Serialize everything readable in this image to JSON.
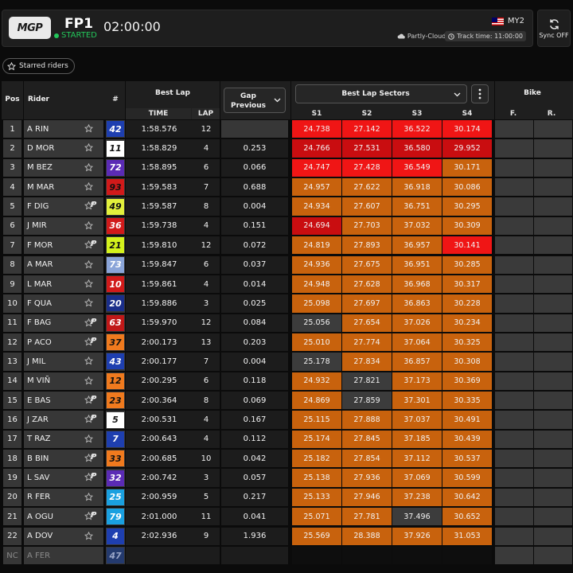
{
  "header": {
    "logo_text": "MGP",
    "session": "FP1",
    "status": "STARTED",
    "clock": "02:00:00",
    "circuit": "MY2",
    "weather": "Partly-Cloudy",
    "track_time": "Track time: 11:00:00",
    "sync_label": "Sync OFF"
  },
  "starred_label": "Starred riders",
  "columns": {
    "pos": "Pos",
    "rider": "Rider",
    "num": "#",
    "best_lap": "Best Lap",
    "time": "TIME",
    "lap": "LAP",
    "gap": "Gap Previous",
    "sectors": "Best Lap Sectors",
    "s1": "S1",
    "s2": "S2",
    "s3": "S3",
    "s4": "S4",
    "bike": "Bike",
    "f": "F.",
    "r": "R."
  },
  "colors": {
    "purple": "#f01515",
    "red_dark": "#c90d10",
    "orange": "#c8620d",
    "grey": "#3c3c3c",
    "green": "#23c65a"
  },
  "rows": [
    {
      "pos": "1",
      "rider": "A RIN",
      "p": false,
      "num": "42",
      "num_bg": "#1e3fb0",
      "num_fg": "#ffffff",
      "time": "1:58.576",
      "lap": "12",
      "gap": "",
      "s": [
        "24.738",
        "27.142",
        "36.522",
        "30.174"
      ],
      "sc": [
        "#f01515",
        "#f01515",
        "#f01515",
        "#f01515"
      ]
    },
    {
      "pos": "2",
      "rider": "D MOR",
      "p": false,
      "num": "11",
      "num_bg": "#ffffff",
      "num_fg": "#111111",
      "time": "1:58.829",
      "lap": "4",
      "gap": "0.253",
      "s": [
        "24.766",
        "27.531",
        "36.580",
        "29.952"
      ],
      "sc": [
        "#c90d10",
        "#c90d10",
        "#c90d10",
        "#c90d10"
      ]
    },
    {
      "pos": "3",
      "rider": "M BEZ",
      "p": false,
      "num": "72",
      "num_bg": "#5b2bb5",
      "num_fg": "#ffffff",
      "time": "1:58.895",
      "lap": "6",
      "gap": "0.066",
      "s": [
        "24.747",
        "27.428",
        "36.549",
        "30.171"
      ],
      "sc": [
        "#f01515",
        "#f01515",
        "#f01515",
        "#c8620d"
      ]
    },
    {
      "pos": "4",
      "rider": "M MAR",
      "p": false,
      "num": "93",
      "num_bg": "#d11a1a",
      "num_fg": "#111111",
      "time": "1:59.583",
      "lap": "7",
      "gap": "0.688",
      "s": [
        "24.957",
        "27.622",
        "36.918",
        "30.086"
      ],
      "sc": [
        "#c8620d",
        "#c8620d",
        "#c8620d",
        "#c8620d"
      ]
    },
    {
      "pos": "5",
      "rider": "F DIG",
      "p": true,
      "num": "49",
      "num_bg": "#e2f03c",
      "num_fg": "#111111",
      "time": "1:59.587",
      "lap": "8",
      "gap": "0.004",
      "s": [
        "24.934",
        "27.607",
        "36.751",
        "30.295"
      ],
      "sc": [
        "#c8620d",
        "#c8620d",
        "#c8620d",
        "#c8620d"
      ]
    },
    {
      "pos": "6",
      "rider": "J MIR",
      "p": false,
      "num": "36",
      "num_bg": "#d11a1a",
      "num_fg": "#ffffff",
      "time": "1:59.738",
      "lap": "4",
      "gap": "0.151",
      "s": [
        "24.694",
        "27.703",
        "37.032",
        "30.309"
      ],
      "sc": [
        "#c90d10",
        "#c8620d",
        "#c8620d",
        "#c8620d"
      ]
    },
    {
      "pos": "7",
      "rider": "F MOR",
      "p": true,
      "num": "21",
      "num_bg": "#d4f21c",
      "num_fg": "#111111",
      "time": "1:59.810",
      "lap": "12",
      "gap": "0.072",
      "s": [
        "24.819",
        "27.893",
        "36.957",
        "30.141"
      ],
      "sc": [
        "#c8620d",
        "#c8620d",
        "#c8620d",
        "#f01515"
      ]
    },
    {
      "pos": "8",
      "rider": "A MAR",
      "p": false,
      "num": "73",
      "num_bg": "#8aa4d8",
      "num_fg": "#ffffff",
      "time": "1:59.847",
      "lap": "6",
      "gap": "0.037",
      "s": [
        "24.936",
        "27.675",
        "36.951",
        "30.285"
      ],
      "sc": [
        "#c8620d",
        "#c8620d",
        "#c8620d",
        "#c8620d"
      ]
    },
    {
      "pos": "9",
      "rider": "L MAR",
      "p": false,
      "num": "10",
      "num_bg": "#d11a1a",
      "num_fg": "#ffffff",
      "time": "1:59.861",
      "lap": "4",
      "gap": "0.014",
      "s": [
        "24.948",
        "27.628",
        "36.968",
        "30.317"
      ],
      "sc": [
        "#c8620d",
        "#c8620d",
        "#c8620d",
        "#c8620d"
      ]
    },
    {
      "pos": "10",
      "rider": "F QUA",
      "p": false,
      "num": "20",
      "num_bg": "#1a2e8a",
      "num_fg": "#ffffff",
      "time": "1:59.886",
      "lap": "3",
      "gap": "0.025",
      "s": [
        "25.098",
        "27.697",
        "36.863",
        "30.228"
      ],
      "sc": [
        "#c8620d",
        "#c8620d",
        "#c8620d",
        "#c8620d"
      ]
    },
    {
      "pos": "11",
      "rider": "F BAG",
      "p": true,
      "num": "63",
      "num_bg": "#c01818",
      "num_fg": "#ffffff",
      "time": "1:59.970",
      "lap": "12",
      "gap": "0.084",
      "s": [
        "25.056",
        "27.654",
        "37.026",
        "30.234"
      ],
      "sc": [
        "#3c3c3c",
        "#c8620d",
        "#c8620d",
        "#c8620d"
      ]
    },
    {
      "pos": "12",
      "rider": "P ACO",
      "p": true,
      "num": "37",
      "num_bg": "#f07a1e",
      "num_fg": "#111111",
      "time": "2:00.173",
      "lap": "13",
      "gap": "0.203",
      "s": [
        "25.010",
        "27.774",
        "37.064",
        "30.325"
      ],
      "sc": [
        "#c8620d",
        "#c8620d",
        "#c8620d",
        "#c8620d"
      ]
    },
    {
      "pos": "13",
      "rider": "J MIL",
      "p": false,
      "num": "43",
      "num_bg": "#1e3fb0",
      "num_fg": "#ffffff",
      "time": "2:00.177",
      "lap": "7",
      "gap": "0.004",
      "s": [
        "25.178",
        "27.834",
        "36.857",
        "30.308"
      ],
      "sc": [
        "#3c3c3c",
        "#c8620d",
        "#c8620d",
        "#c8620d"
      ]
    },
    {
      "pos": "14",
      "rider": "M VIÑ",
      "p": false,
      "num": "12",
      "num_bg": "#f07a1e",
      "num_fg": "#111111",
      "time": "2:00.295",
      "lap": "6",
      "gap": "0.118",
      "s": [
        "24.932",
        "27.821",
        "37.173",
        "30.369"
      ],
      "sc": [
        "#c8620d",
        "#3c3c3c",
        "#c8620d",
        "#c8620d"
      ]
    },
    {
      "pos": "15",
      "rider": "E BAS",
      "p": true,
      "num": "23",
      "num_bg": "#f07a1e",
      "num_fg": "#111111",
      "time": "2:00.364",
      "lap": "8",
      "gap": "0.069",
      "s": [
        "24.869",
        "27.859",
        "37.301",
        "30.335"
      ],
      "sc": [
        "#c8620d",
        "#3c3c3c",
        "#c8620d",
        "#c8620d"
      ]
    },
    {
      "pos": "16",
      "rider": "J ZAR",
      "p": true,
      "num": "5",
      "num_bg": "#ffffff",
      "num_fg": "#111111",
      "time": "2:00.531",
      "lap": "4",
      "gap": "0.167",
      "s": [
        "25.115",
        "27.888",
        "37.037",
        "30.491"
      ],
      "sc": [
        "#c8620d",
        "#c8620d",
        "#c8620d",
        "#c8620d"
      ]
    },
    {
      "pos": "17",
      "rider": "T RAZ",
      "p": false,
      "num": "7",
      "num_bg": "#1e3fb0",
      "num_fg": "#ffffff",
      "time": "2:00.643",
      "lap": "4",
      "gap": "0.112",
      "s": [
        "25.174",
        "27.845",
        "37.185",
        "30.439"
      ],
      "sc": [
        "#c8620d",
        "#c8620d",
        "#c8620d",
        "#c8620d"
      ]
    },
    {
      "pos": "18",
      "rider": "B BIN",
      "p": true,
      "num": "33",
      "num_bg": "#f07a1e",
      "num_fg": "#111111",
      "time": "2:00.685",
      "lap": "10",
      "gap": "0.042",
      "s": [
        "25.182",
        "27.854",
        "37.112",
        "30.537"
      ],
      "sc": [
        "#c8620d",
        "#c8620d",
        "#c8620d",
        "#c8620d"
      ]
    },
    {
      "pos": "19",
      "rider": "L SAV",
      "p": true,
      "num": "32",
      "num_bg": "#5b2bb5",
      "num_fg": "#ffffff",
      "time": "2:00.742",
      "lap": "3",
      "gap": "0.057",
      "s": [
        "25.138",
        "27.936",
        "37.069",
        "30.599"
      ],
      "sc": [
        "#c8620d",
        "#c8620d",
        "#c8620d",
        "#c8620d"
      ]
    },
    {
      "pos": "20",
      "rider": "R FER",
      "p": false,
      "num": "25",
      "num_bg": "#1aa0e0",
      "num_fg": "#ffffff",
      "time": "2:00.959",
      "lap": "5",
      "gap": "0.217",
      "s": [
        "25.133",
        "27.946",
        "37.238",
        "30.642"
      ],
      "sc": [
        "#c8620d",
        "#c8620d",
        "#c8620d",
        "#c8620d"
      ]
    },
    {
      "pos": "21",
      "rider": "A OGU",
      "p": true,
      "num": "79",
      "num_bg": "#1aa0e0",
      "num_fg": "#ffffff",
      "time": "2:01.000",
      "lap": "11",
      "gap": "0.041",
      "s": [
        "25.071",
        "27.781",
        "37.496",
        "30.652"
      ],
      "sc": [
        "#c8620d",
        "#c8620d",
        "#3c3c3c",
        "#c8620d"
      ]
    },
    {
      "pos": "22",
      "rider": "A DOV",
      "p": false,
      "num": "4",
      "num_bg": "#1e3fb0",
      "num_fg": "#ffffff",
      "time": "2:02.936",
      "lap": "9",
      "gap": "1.936",
      "s": [
        "25.569",
        "28.388",
        "37.926",
        "31.053"
      ],
      "sc": [
        "#c8620d",
        "#c8620d",
        "#c8620d",
        "#c8620d"
      ]
    },
    {
      "pos": "NC",
      "rider": "A FER",
      "p": false,
      "num": "47",
      "num_bg": "#243a6e",
      "num_fg": "#9aa6c8",
      "time": "",
      "lap": "",
      "gap": "",
      "s": [
        "",
        "",
        "",
        ""
      ],
      "sc": [
        "",
        "",
        "",
        ""
      ],
      "dim": true
    }
  ]
}
